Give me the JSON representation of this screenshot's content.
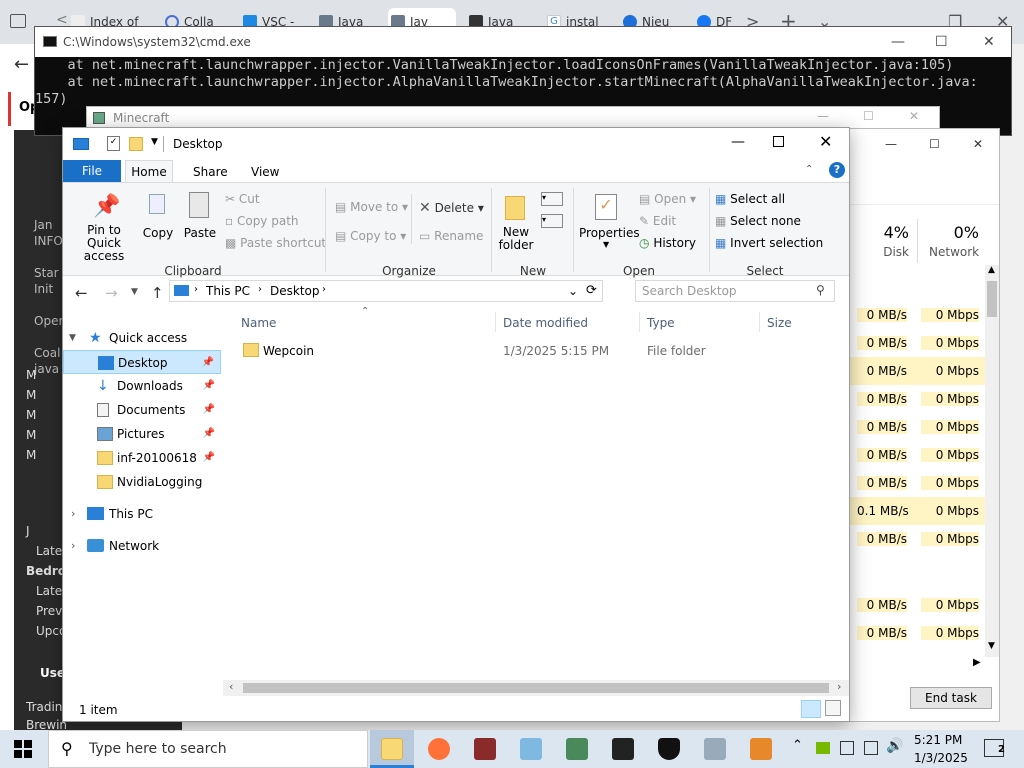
{
  "browser": {
    "tabs": [
      "Index of",
      "Colla",
      "VSC -",
      "Java",
      "Jav",
      "Java",
      "instal",
      "Nieu",
      "DF"
    ]
  },
  "left_page": {
    "top_label": "Op",
    "lines": [
      "Jan",
      "INFO",
      "Star",
      "Init",
      "Oper",
      "Coal",
      "java"
    ],
    "sidebar": [
      "M",
      "M",
      "M",
      "M",
      "M",
      "J",
      "Lates",
      "Bedro",
      "Lates",
      "Previ",
      "Upco",
      "Use",
      "Tradin",
      "Brewin"
    ]
  },
  "cmd": {
    "title": "C:\\Windows\\system32\\cmd.exe",
    "lines": [
      "    at net.minecraft.launchwrapper.injector.VanillaTweakInjector.loadIconsOnFrames(VanillaTweakInjector.java:105)",
      "    at net.minecraft.launchwrapper.injector.AlphaVanillaTweakInjector.startMinecraft(AlphaVanillaTweakInjector.java:",
      "157)"
    ]
  },
  "minecraft": {
    "title": "Minecraft"
  },
  "task_manager": {
    "disk_pct": "4%",
    "disk_label": "Disk",
    "net_pct": "0%",
    "net_label": "Network",
    "rows": [
      {
        "disk": "0 MB/s",
        "net": "0 Mbps"
      },
      {
        "disk": "0 MB/s",
        "net": "0 Mbps"
      },
      {
        "disk": "0 MB/s",
        "net": "0 Mbps"
      },
      {
        "disk": "0 MB/s",
        "net": "0 Mbps"
      },
      {
        "disk": "0 MB/s",
        "net": "0 Mbps"
      },
      {
        "disk": "0 MB/s",
        "net": "0 Mbps"
      },
      {
        "disk": "0 MB/s",
        "net": "0 Mbps"
      },
      {
        "disk": "0.1 MB/s",
        "net": "0 Mbps"
      },
      {
        "disk": "0 MB/s",
        "net": "0 Mbps"
      },
      {
        "disk": "0 MB/s",
        "net": "0 Mbps"
      },
      {
        "disk": "0 MB/s",
        "net": "0 Mbps"
      }
    ],
    "end_task": "End task"
  },
  "explorer": {
    "title": "Desktop",
    "ribbon_tabs": [
      "File",
      "Home",
      "Share",
      "View"
    ],
    "clipboard": {
      "pin": "Pin to Quick access",
      "copy": "Copy",
      "paste": "Paste",
      "cut": "Cut",
      "copy_path": "Copy path",
      "paste_shortcut": "Paste shortcut",
      "label": "Clipboard"
    },
    "organize": {
      "move_to": "Move to",
      "copy_to": "Copy to",
      "delete": "Delete",
      "rename": "Rename",
      "label": "Organize"
    },
    "new": {
      "new_folder": "New folder",
      "label": "New"
    },
    "open": {
      "properties": "Properties",
      "open": "Open",
      "edit": "Edit",
      "history": "History",
      "label": "Open"
    },
    "select": {
      "select_all": "Select all",
      "select_none": "Select none",
      "invert": "Invert selection",
      "label": "Select"
    },
    "address": {
      "this_pc": "This PC",
      "desktop": "Desktop"
    },
    "search_placeholder": "Search Desktop",
    "nav": [
      {
        "label": "Quick access"
      },
      {
        "label": "Desktop"
      },
      {
        "label": "Downloads"
      },
      {
        "label": "Documents"
      },
      {
        "label": "Pictures"
      },
      {
        "label": "inf-20100618"
      },
      {
        "label": "NvidiaLogging"
      },
      {
        "label": "This PC"
      },
      {
        "label": "Network"
      }
    ],
    "columns": {
      "name": "Name",
      "date": "Date modified",
      "type": "Type",
      "size": "Size"
    },
    "files": [
      {
        "name": "Wepcoin",
        "date": "1/3/2025 5:15 PM",
        "type": "File folder",
        "size": ""
      }
    ],
    "status": "1 item"
  },
  "taskbar": {
    "search_placeholder": "Type here to search",
    "time": "5:21 PM",
    "date": "1/3/2025",
    "notification_count": "2"
  },
  "colors": {
    "accent": "#0063b1",
    "folder": "#f8d775",
    "cpu_highlight": "#fff4c4"
  }
}
